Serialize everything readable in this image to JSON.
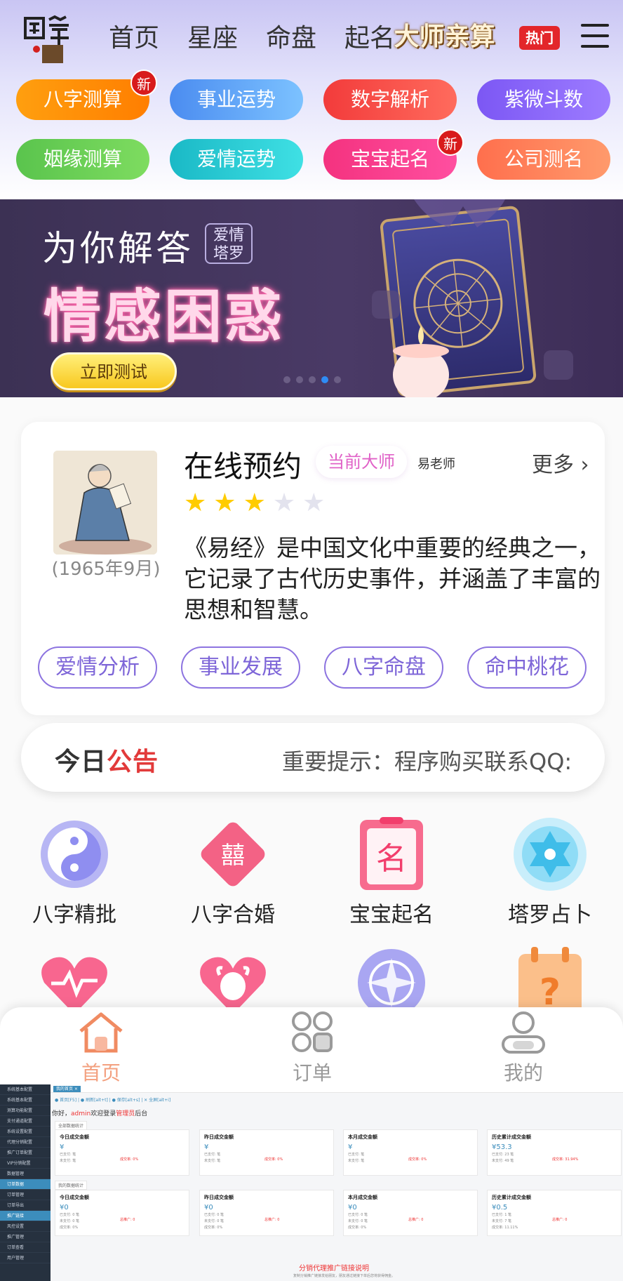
{
  "header": {
    "logo_text": "国学",
    "nav": [
      "首页",
      "星座",
      "命盘",
      "起名"
    ],
    "master_btn": "大师亲算",
    "hot_badge": "热门"
  },
  "categories": [
    {
      "label": "八字测算",
      "new": "新",
      "color_from": "#ff9f0f",
      "color_to": "#ff7e00"
    },
    {
      "label": "事业运势",
      "new": "",
      "color_from": "#4b8cf0",
      "color_to": "#7cc2ff"
    },
    {
      "label": "数字解析",
      "new": "",
      "color_from": "#f23b3b",
      "color_to": "#ff6b5d"
    },
    {
      "label": "紫微斗数",
      "new": "",
      "color_from": "#7c57f4",
      "color_to": "#9d7cff"
    },
    {
      "label": "姻缘测算",
      "new": "",
      "color_from": "#5ac44d",
      "color_to": "#7edc60"
    },
    {
      "label": "爱情运势",
      "new": "",
      "color_from": "#1ab9c6",
      "color_to": "#3fe0e4"
    },
    {
      "label": "宝宝起名",
      "new": "新",
      "color_from": "#f4327f",
      "color_to": "#ff4fa0"
    },
    {
      "label": "公司测名",
      "new": "",
      "color_from": "#ff6f4d",
      "color_to": "#ff9a6c"
    }
  ],
  "banner": {
    "line1": "为你解答",
    "tag": "爱情\n塔罗",
    "line2": "情感困惑",
    "button": "立即测试",
    "active_dot": 3
  },
  "booking": {
    "title": "在线预约",
    "current_master": "当前大师",
    "teacher": "易老师",
    "more": "更多",
    "birth": "(1965年9月)",
    "rating": 3,
    "rating_max": 5,
    "description": "《易经》是中国文化中重要的经典之一，它记录了古代历史事件，并涵盖了丰富的思想和智慧。",
    "tags": [
      "爱情分析",
      "事业发展",
      "八字命盘",
      "命中桃花"
    ]
  },
  "notice": {
    "title_a": "今日",
    "title_b": "公告",
    "text": "重要提示：程序购买联系QQ:"
  },
  "services": [
    {
      "label": "八字精批",
      "icon": "yin-yang-icon"
    },
    {
      "label": "八字合婚",
      "icon": "double-happiness-icon"
    },
    {
      "label": "宝宝起名",
      "icon": "name-card-icon"
    },
    {
      "label": "塔罗占卜",
      "icon": "hexagram-icon"
    },
    {
      "label": "",
      "icon": "heart-pulse-icon"
    },
    {
      "label": "",
      "icon": "ox-heart-icon"
    },
    {
      "label": "",
      "icon": "compass-icon"
    },
    {
      "label": "",
      "icon": "question-calendar-icon"
    }
  ],
  "tabbar": [
    {
      "label": "首页",
      "icon": "home-icon",
      "active": true
    },
    {
      "label": "订单",
      "icon": "grid-icon",
      "active": false
    },
    {
      "label": "我的",
      "icon": "user-icon",
      "active": false
    }
  ],
  "admin": {
    "tab": "我的首页 ×",
    "links": "● 首页[F5]  |  ● 刷新[alt+t]  |  ● 保存[alt+s]  |  ✕ 全屏[alt+i]",
    "welcome_prefix": "你好，",
    "welcome_user": "admin",
    "welcome_mid": "欢迎登录",
    "welcome_role": "管理员",
    "welcome_suffix": "后台",
    "section1": "全部数据统计",
    "section2": "我的数据统计",
    "sidebar": [
      "系统基本配置",
      "系统基本配置",
      "测算功能配置",
      "支付通道配置",
      "系统设置配置",
      "代理分销配置",
      "推广订单配置",
      "VIP分销配置",
      "数据管理",
      "订单数据",
      "订单管理",
      "订单导出",
      "推广链接",
      "风控设置",
      "推广管理",
      "订单查看",
      "用户管理"
    ],
    "stats1": [
      {
        "title": "今日成交金额",
        "value": "¥",
        "l1": "已支付: 笔",
        "l2": "未支付: 笔",
        "rate": "成交率: 0%"
      },
      {
        "title": "昨日成交金额",
        "value": "¥",
        "l1": "已支付: 笔",
        "l2": "未支付: 笔",
        "rate": "成交率: 0%"
      },
      {
        "title": "本月成交金额",
        "value": "¥",
        "l1": "已支付: 笔",
        "l2": "未支付: 笔",
        "rate": "成交率: 0%"
      },
      {
        "title": "历史累计成交金额",
        "value": "¥53.3",
        "l1": "已支付: 23 笔",
        "l2": "未支付: 49 笔",
        "rate": "成交率: 31.94%"
      }
    ],
    "stats2": [
      {
        "title": "今日成交金额",
        "value": "¥0",
        "l1": "已支付: 0 笔",
        "l2": "未支付: 0 笔",
        "l3": "成交率: 0%",
        "rate": "总推广: 0"
      },
      {
        "title": "昨日成交金额",
        "value": "¥0",
        "l1": "已支付: 0 笔",
        "l2": "未支付: 0 笔",
        "l3": "成交率: 0%",
        "rate": "总推广: 0"
      },
      {
        "title": "本月成交金额",
        "value": "¥0",
        "l1": "已支付: 0 笔",
        "l2": "未支付: 0 笔",
        "l3": "成交率: 0%",
        "rate": "总推广: 0"
      },
      {
        "title": "历史累计成交金额",
        "value": "¥0.5",
        "l1": "已支付: 1 笔",
        "l2": "未支付: 7 笔",
        "l3": "成交率: 11.11%",
        "rate": "总推广: 0"
      }
    ],
    "footer_title": "分销代理推广链接说明",
    "footer_text": "复制分销推广链接发给朋友，朋友通过链接下单后您将获得佣金。"
  }
}
